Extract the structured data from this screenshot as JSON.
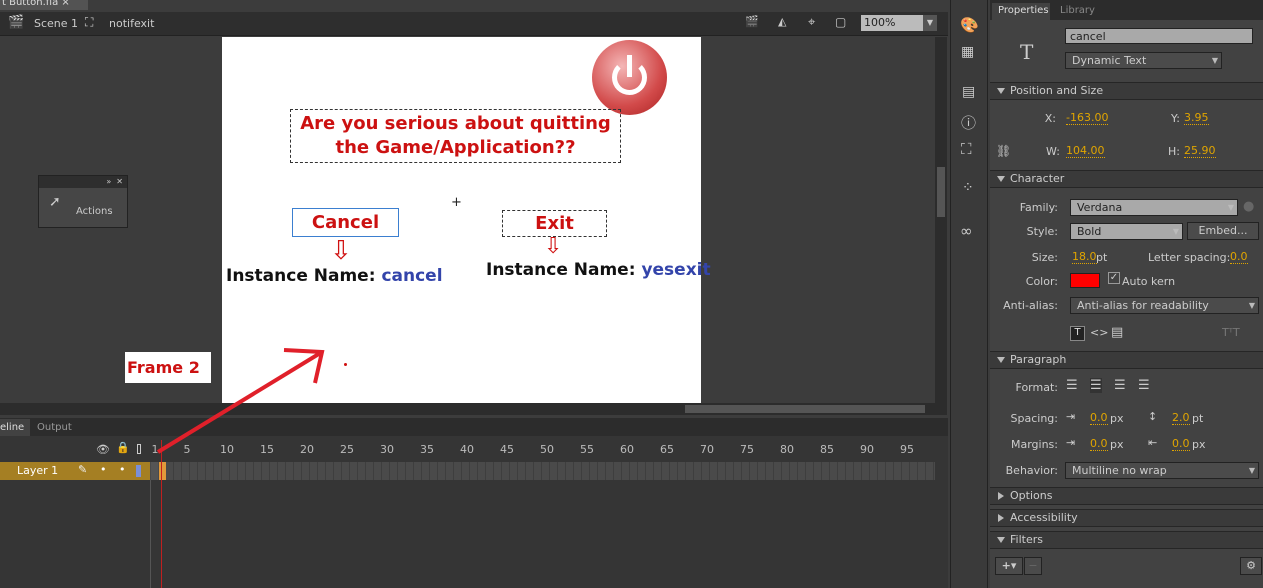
{
  "file_tab": {
    "label": "t Button.fla",
    "close": "×"
  },
  "scene_bar": {
    "scene": "Scene 1",
    "symbol": "notifexit",
    "zoom": "100%"
  },
  "stage": {
    "question_line1": "Are you serious about quitting",
    "question_line2": "the Game/Application??",
    "cancel_label": "Cancel",
    "exit_label": "Exit",
    "cancel_instance_prefix": "Instance Name: ",
    "cancel_instance_name": "cancel",
    "exit_instance_prefix": "Instance Name: ",
    "exit_instance_name": "yesexit",
    "label_color": "#cc1111",
    "instance_color": "#3344aa"
  },
  "annotation": {
    "frame_label": "Frame 2",
    "arrow_color": "#e0202a"
  },
  "actions_panel": {
    "label": "Actions"
  },
  "properties": {
    "tabs": [
      "Properties",
      "Library"
    ],
    "instance_name": "cancel",
    "text_type": "Dynamic Text",
    "position_size": {
      "title": "Position and Size",
      "x_label": "X:",
      "x": "-163.00",
      "y_label": "Y:",
      "y": "3.95",
      "w_label": "W:",
      "w": "104.00",
      "h_label": "H:",
      "h": "25.90"
    },
    "character": {
      "title": "Character",
      "family_label": "Family:",
      "family": "Verdana",
      "style_label": "Style:",
      "style": "Bold",
      "embed": "Embed...",
      "size_label": "Size:",
      "size": "18.0",
      "size_unit": "pt",
      "letter_spacing_label": "Letter spacing:",
      "letter_spacing": "0.0",
      "color_label": "Color:",
      "color": "#ff0000",
      "auto_kern": "Auto kern",
      "antialias_label": "Anti-alias:",
      "antialias": "Anti-alias for readability"
    },
    "paragraph": {
      "title": "Paragraph",
      "format_label": "Format:",
      "spacing_label": "Spacing:",
      "spacing_indent": "0.0",
      "spacing_indent_unit": "px",
      "line_spacing": "2.0",
      "line_spacing_unit": "pt",
      "margins_label": "Margins:",
      "margin_left": "0.0",
      "margin_left_unit": "px",
      "margin_right": "0.0",
      "margin_right_unit": "px",
      "behavior_label": "Behavior:",
      "behavior": "Multiline no wrap"
    },
    "options": "Options",
    "accessibility": "Accessibility",
    "filters": "Filters"
  },
  "timeline": {
    "tabs": [
      "eline",
      "Output"
    ],
    "layer": "Layer 1",
    "frame_numbers": [
      "1",
      "5",
      "10",
      "15",
      "20",
      "25",
      "30",
      "35",
      "40",
      "45",
      "50",
      "55",
      "60",
      "65",
      "70",
      "75",
      "80",
      "85",
      "90",
      "95"
    ]
  }
}
